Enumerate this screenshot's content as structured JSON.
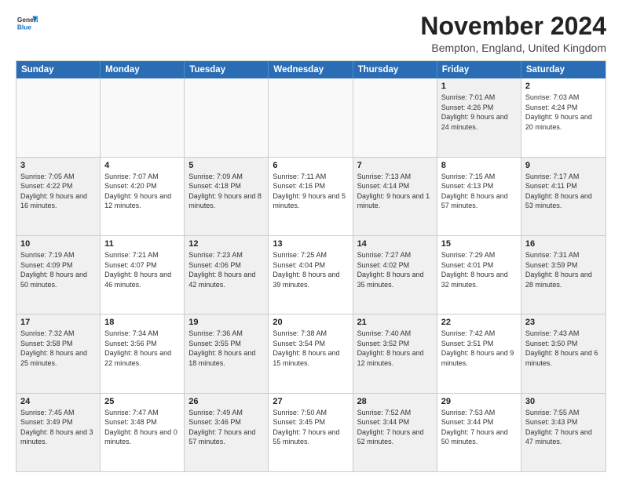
{
  "logo": {
    "text1": "General",
    "text2": "Blue"
  },
  "title": "November 2024",
  "subtitle": "Bempton, England, United Kingdom",
  "calendar": {
    "headers": [
      "Sunday",
      "Monday",
      "Tuesday",
      "Wednesday",
      "Thursday",
      "Friday",
      "Saturday"
    ],
    "weeks": [
      [
        {
          "day": "",
          "info": "",
          "empty": true
        },
        {
          "day": "",
          "info": "",
          "empty": true
        },
        {
          "day": "",
          "info": "",
          "empty": true
        },
        {
          "day": "",
          "info": "",
          "empty": true
        },
        {
          "day": "",
          "info": "",
          "empty": true
        },
        {
          "day": "1",
          "info": "Sunrise: 7:01 AM\nSunset: 4:26 PM\nDaylight: 9 hours and 24 minutes.",
          "shaded": true
        },
        {
          "day": "2",
          "info": "Sunrise: 7:03 AM\nSunset: 4:24 PM\nDaylight: 9 hours and 20 minutes."
        }
      ],
      [
        {
          "day": "3",
          "info": "Sunrise: 7:05 AM\nSunset: 4:22 PM\nDaylight: 9 hours and 16 minutes.",
          "shaded": true
        },
        {
          "day": "4",
          "info": "Sunrise: 7:07 AM\nSunset: 4:20 PM\nDaylight: 9 hours and 12 minutes."
        },
        {
          "day": "5",
          "info": "Sunrise: 7:09 AM\nSunset: 4:18 PM\nDaylight: 9 hours and 8 minutes.",
          "shaded": true
        },
        {
          "day": "6",
          "info": "Sunrise: 7:11 AM\nSunset: 4:16 PM\nDaylight: 9 hours and 5 minutes."
        },
        {
          "day": "7",
          "info": "Sunrise: 7:13 AM\nSunset: 4:14 PM\nDaylight: 9 hours and 1 minute.",
          "shaded": true
        },
        {
          "day": "8",
          "info": "Sunrise: 7:15 AM\nSunset: 4:13 PM\nDaylight: 8 hours and 57 minutes."
        },
        {
          "day": "9",
          "info": "Sunrise: 7:17 AM\nSunset: 4:11 PM\nDaylight: 8 hours and 53 minutes.",
          "shaded": true
        }
      ],
      [
        {
          "day": "10",
          "info": "Sunrise: 7:19 AM\nSunset: 4:09 PM\nDaylight: 8 hours and 50 minutes.",
          "shaded": true
        },
        {
          "day": "11",
          "info": "Sunrise: 7:21 AM\nSunset: 4:07 PM\nDaylight: 8 hours and 46 minutes."
        },
        {
          "day": "12",
          "info": "Sunrise: 7:23 AM\nSunset: 4:06 PM\nDaylight: 8 hours and 42 minutes.",
          "shaded": true
        },
        {
          "day": "13",
          "info": "Sunrise: 7:25 AM\nSunset: 4:04 PM\nDaylight: 8 hours and 39 minutes."
        },
        {
          "day": "14",
          "info": "Sunrise: 7:27 AM\nSunset: 4:02 PM\nDaylight: 8 hours and 35 minutes.",
          "shaded": true
        },
        {
          "day": "15",
          "info": "Sunrise: 7:29 AM\nSunset: 4:01 PM\nDaylight: 8 hours and 32 minutes."
        },
        {
          "day": "16",
          "info": "Sunrise: 7:31 AM\nSunset: 3:59 PM\nDaylight: 8 hours and 28 minutes.",
          "shaded": true
        }
      ],
      [
        {
          "day": "17",
          "info": "Sunrise: 7:32 AM\nSunset: 3:58 PM\nDaylight: 8 hours and 25 minutes.",
          "shaded": true
        },
        {
          "day": "18",
          "info": "Sunrise: 7:34 AM\nSunset: 3:56 PM\nDaylight: 8 hours and 22 minutes."
        },
        {
          "day": "19",
          "info": "Sunrise: 7:36 AM\nSunset: 3:55 PM\nDaylight: 8 hours and 18 minutes.",
          "shaded": true
        },
        {
          "day": "20",
          "info": "Sunrise: 7:38 AM\nSunset: 3:54 PM\nDaylight: 8 hours and 15 minutes."
        },
        {
          "day": "21",
          "info": "Sunrise: 7:40 AM\nSunset: 3:52 PM\nDaylight: 8 hours and 12 minutes.",
          "shaded": true
        },
        {
          "day": "22",
          "info": "Sunrise: 7:42 AM\nSunset: 3:51 PM\nDaylight: 8 hours and 9 minutes."
        },
        {
          "day": "23",
          "info": "Sunrise: 7:43 AM\nSunset: 3:50 PM\nDaylight: 8 hours and 6 minutes.",
          "shaded": true
        }
      ],
      [
        {
          "day": "24",
          "info": "Sunrise: 7:45 AM\nSunset: 3:49 PM\nDaylight: 8 hours and 3 minutes.",
          "shaded": true
        },
        {
          "day": "25",
          "info": "Sunrise: 7:47 AM\nSunset: 3:48 PM\nDaylight: 8 hours and 0 minutes."
        },
        {
          "day": "26",
          "info": "Sunrise: 7:49 AM\nSunset: 3:46 PM\nDaylight: 7 hours and 57 minutes.",
          "shaded": true
        },
        {
          "day": "27",
          "info": "Sunrise: 7:50 AM\nSunset: 3:45 PM\nDaylight: 7 hours and 55 minutes."
        },
        {
          "day": "28",
          "info": "Sunrise: 7:52 AM\nSunset: 3:44 PM\nDaylight: 7 hours and 52 minutes.",
          "shaded": true
        },
        {
          "day": "29",
          "info": "Sunrise: 7:53 AM\nSunset: 3:44 PM\nDaylight: 7 hours and 50 minutes."
        },
        {
          "day": "30",
          "info": "Sunrise: 7:55 AM\nSunset: 3:43 PM\nDaylight: 7 hours and 47 minutes.",
          "shaded": true
        }
      ]
    ]
  }
}
